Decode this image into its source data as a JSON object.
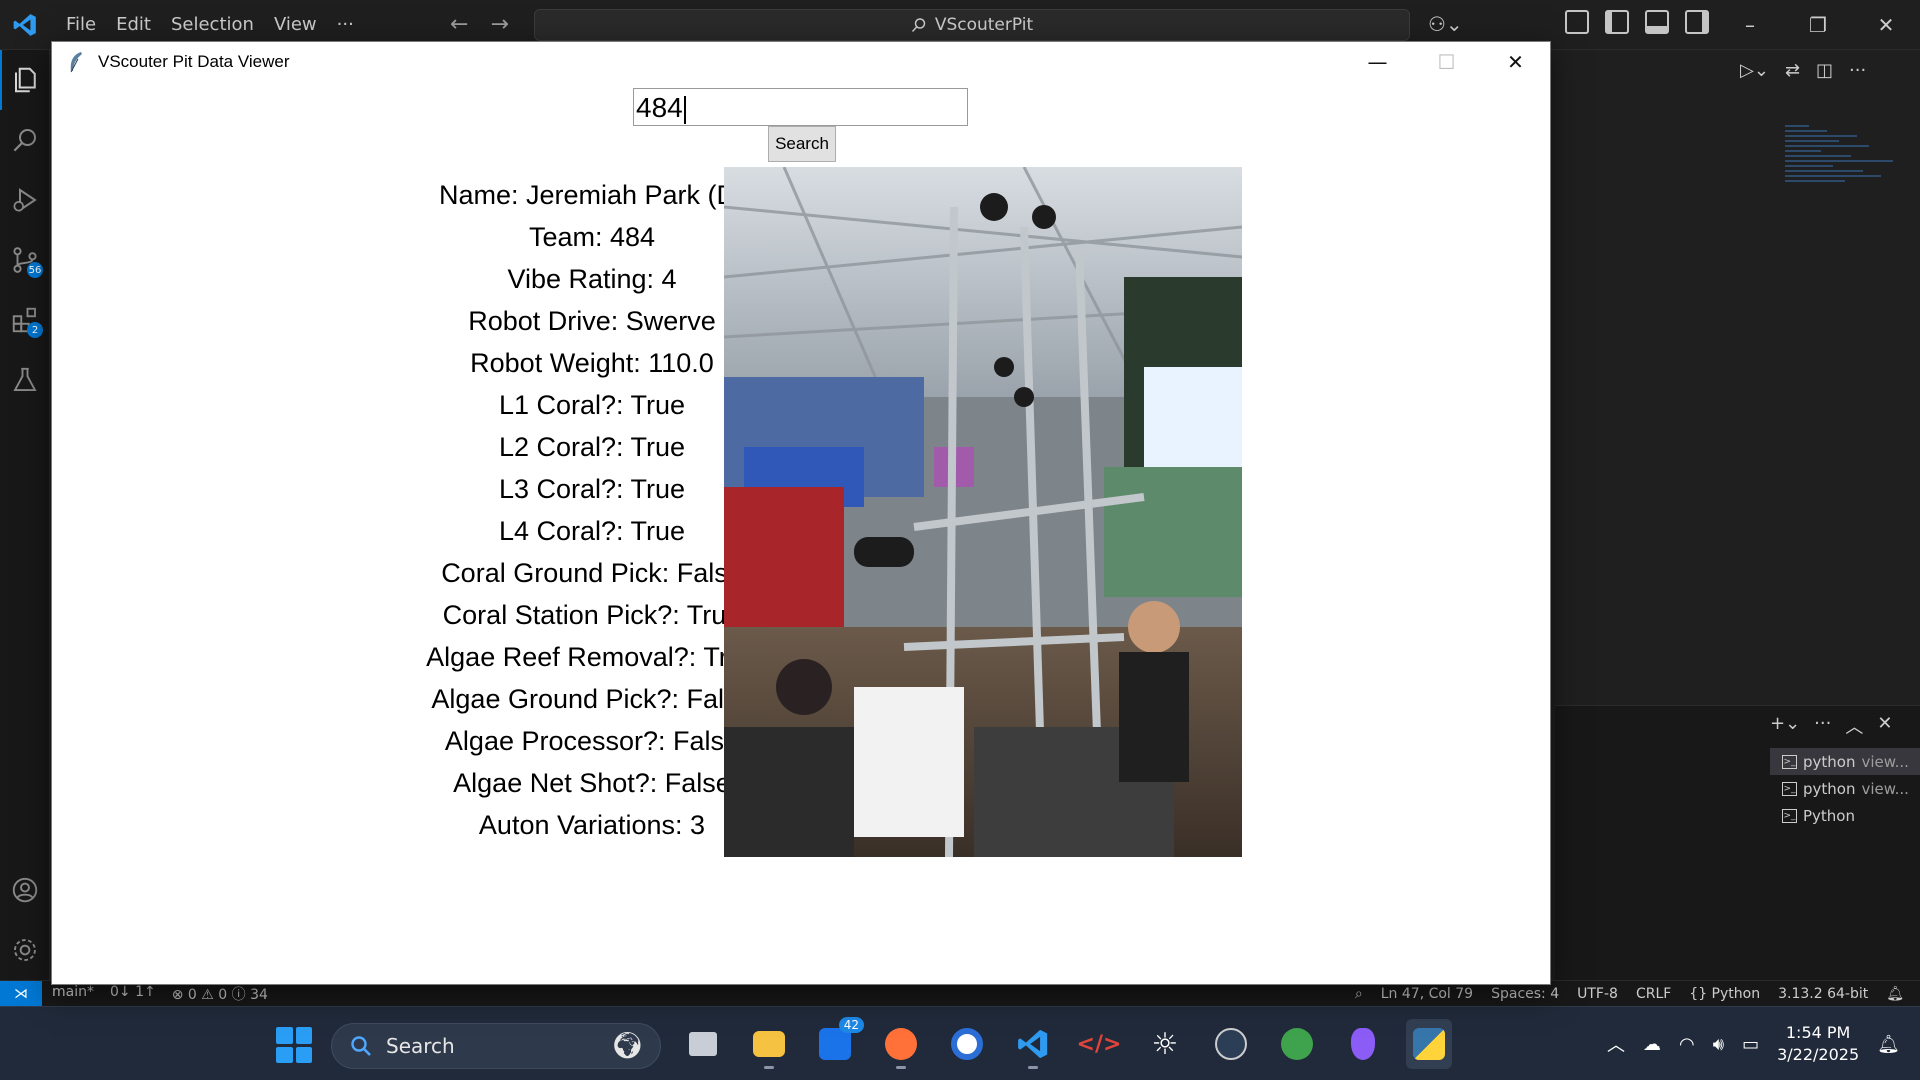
{
  "vscode": {
    "menu": [
      "File",
      "Edit",
      "Selection",
      "View",
      "···"
    ],
    "command_center": "VScouterPit",
    "activity_badges": {
      "source_control": "56",
      "extensions": "2"
    }
  },
  "tk_window": {
    "title": "VScouter Pit Data Viewer",
    "search_value": "484",
    "search_button": "Search",
    "fields": [
      "Name: Jeremiah Park (D)",
      "Team: 484",
      "Vibe Rating: 4",
      "Robot Drive: Swerve",
      "Robot Weight: 110.0",
      "L1 Coral?: True",
      "L2 Coral?: True",
      "L3 Coral?: True",
      "L4 Coral?: True",
      "Coral Ground Pick: False",
      "Coral Station Pick?: True",
      "Algae Reef Removal?: True",
      "Algae Ground Pick?: False",
      "Algae Processor?: False",
      "Algae Net Shot?: False",
      "Auton Variations: 3"
    ]
  },
  "terminal": {
    "items": [
      {
        "label": "python",
        "sub": "view..."
      },
      {
        "label": "python",
        "sub": "view..."
      },
      {
        "label": "Python",
        "sub": ""
      }
    ]
  },
  "statusbar": {
    "branch": "main*",
    "sync": "0↓ 1↑",
    "problems": "⊗ 0 ⚠ 0 ⓘ 34",
    "position": "Ln 47, Col 79",
    "spaces": "Spaces: 4",
    "encoding": "UTF-8",
    "eol": "CRLF",
    "language": "{} Python",
    "interpreter": "3.13.2 64-bit"
  },
  "taskbar": {
    "search_label": "Search",
    "mail_badge": "42",
    "time": "1:54 PM",
    "date": "3/22/2025"
  }
}
